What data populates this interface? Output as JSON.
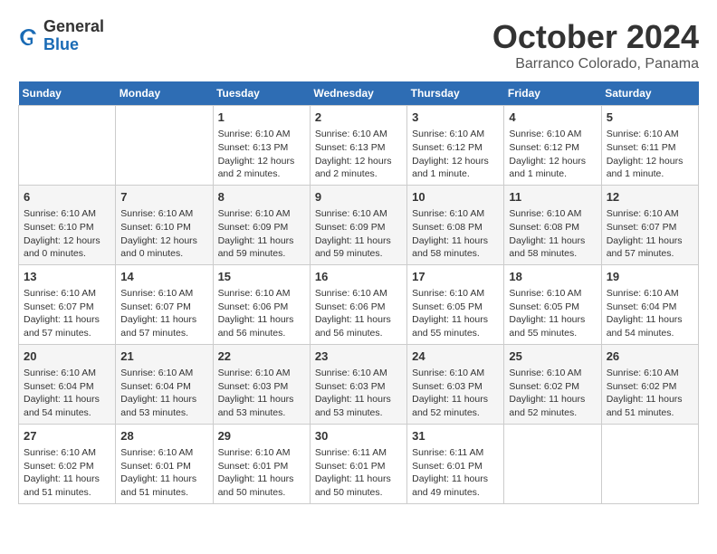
{
  "logo": {
    "general": "General",
    "blue": "Blue"
  },
  "title": "October 2024",
  "location": "Barranco Colorado, Panama",
  "days_header": [
    "Sunday",
    "Monday",
    "Tuesday",
    "Wednesday",
    "Thursday",
    "Friday",
    "Saturday"
  ],
  "weeks": [
    [
      {
        "day": "",
        "info": ""
      },
      {
        "day": "",
        "info": ""
      },
      {
        "day": "1",
        "info": "Sunrise: 6:10 AM\nSunset: 6:13 PM\nDaylight: 12 hours and 2 minutes."
      },
      {
        "day": "2",
        "info": "Sunrise: 6:10 AM\nSunset: 6:13 PM\nDaylight: 12 hours and 2 minutes."
      },
      {
        "day": "3",
        "info": "Sunrise: 6:10 AM\nSunset: 6:12 PM\nDaylight: 12 hours and 1 minute."
      },
      {
        "day": "4",
        "info": "Sunrise: 6:10 AM\nSunset: 6:12 PM\nDaylight: 12 hours and 1 minute."
      },
      {
        "day": "5",
        "info": "Sunrise: 6:10 AM\nSunset: 6:11 PM\nDaylight: 12 hours and 1 minute."
      }
    ],
    [
      {
        "day": "6",
        "info": "Sunrise: 6:10 AM\nSunset: 6:10 PM\nDaylight: 12 hours and 0 minutes."
      },
      {
        "day": "7",
        "info": "Sunrise: 6:10 AM\nSunset: 6:10 PM\nDaylight: 12 hours and 0 minutes."
      },
      {
        "day": "8",
        "info": "Sunrise: 6:10 AM\nSunset: 6:09 PM\nDaylight: 11 hours and 59 minutes."
      },
      {
        "day": "9",
        "info": "Sunrise: 6:10 AM\nSunset: 6:09 PM\nDaylight: 11 hours and 59 minutes."
      },
      {
        "day": "10",
        "info": "Sunrise: 6:10 AM\nSunset: 6:08 PM\nDaylight: 11 hours and 58 minutes."
      },
      {
        "day": "11",
        "info": "Sunrise: 6:10 AM\nSunset: 6:08 PM\nDaylight: 11 hours and 58 minutes."
      },
      {
        "day": "12",
        "info": "Sunrise: 6:10 AM\nSunset: 6:07 PM\nDaylight: 11 hours and 57 minutes."
      }
    ],
    [
      {
        "day": "13",
        "info": "Sunrise: 6:10 AM\nSunset: 6:07 PM\nDaylight: 11 hours and 57 minutes."
      },
      {
        "day": "14",
        "info": "Sunrise: 6:10 AM\nSunset: 6:07 PM\nDaylight: 11 hours and 57 minutes."
      },
      {
        "day": "15",
        "info": "Sunrise: 6:10 AM\nSunset: 6:06 PM\nDaylight: 11 hours and 56 minutes."
      },
      {
        "day": "16",
        "info": "Sunrise: 6:10 AM\nSunset: 6:06 PM\nDaylight: 11 hours and 56 minutes."
      },
      {
        "day": "17",
        "info": "Sunrise: 6:10 AM\nSunset: 6:05 PM\nDaylight: 11 hours and 55 minutes."
      },
      {
        "day": "18",
        "info": "Sunrise: 6:10 AM\nSunset: 6:05 PM\nDaylight: 11 hours and 55 minutes."
      },
      {
        "day": "19",
        "info": "Sunrise: 6:10 AM\nSunset: 6:04 PM\nDaylight: 11 hours and 54 minutes."
      }
    ],
    [
      {
        "day": "20",
        "info": "Sunrise: 6:10 AM\nSunset: 6:04 PM\nDaylight: 11 hours and 54 minutes."
      },
      {
        "day": "21",
        "info": "Sunrise: 6:10 AM\nSunset: 6:04 PM\nDaylight: 11 hours and 53 minutes."
      },
      {
        "day": "22",
        "info": "Sunrise: 6:10 AM\nSunset: 6:03 PM\nDaylight: 11 hours and 53 minutes."
      },
      {
        "day": "23",
        "info": "Sunrise: 6:10 AM\nSunset: 6:03 PM\nDaylight: 11 hours and 53 minutes."
      },
      {
        "day": "24",
        "info": "Sunrise: 6:10 AM\nSunset: 6:03 PM\nDaylight: 11 hours and 52 minutes."
      },
      {
        "day": "25",
        "info": "Sunrise: 6:10 AM\nSunset: 6:02 PM\nDaylight: 11 hours and 52 minutes."
      },
      {
        "day": "26",
        "info": "Sunrise: 6:10 AM\nSunset: 6:02 PM\nDaylight: 11 hours and 51 minutes."
      }
    ],
    [
      {
        "day": "27",
        "info": "Sunrise: 6:10 AM\nSunset: 6:02 PM\nDaylight: 11 hours and 51 minutes."
      },
      {
        "day": "28",
        "info": "Sunrise: 6:10 AM\nSunset: 6:01 PM\nDaylight: 11 hours and 51 minutes."
      },
      {
        "day": "29",
        "info": "Sunrise: 6:10 AM\nSunset: 6:01 PM\nDaylight: 11 hours and 50 minutes."
      },
      {
        "day": "30",
        "info": "Sunrise: 6:11 AM\nSunset: 6:01 PM\nDaylight: 11 hours and 50 minutes."
      },
      {
        "day": "31",
        "info": "Sunrise: 6:11 AM\nSunset: 6:01 PM\nDaylight: 11 hours and 49 minutes."
      },
      {
        "day": "",
        "info": ""
      },
      {
        "day": "",
        "info": ""
      }
    ]
  ]
}
